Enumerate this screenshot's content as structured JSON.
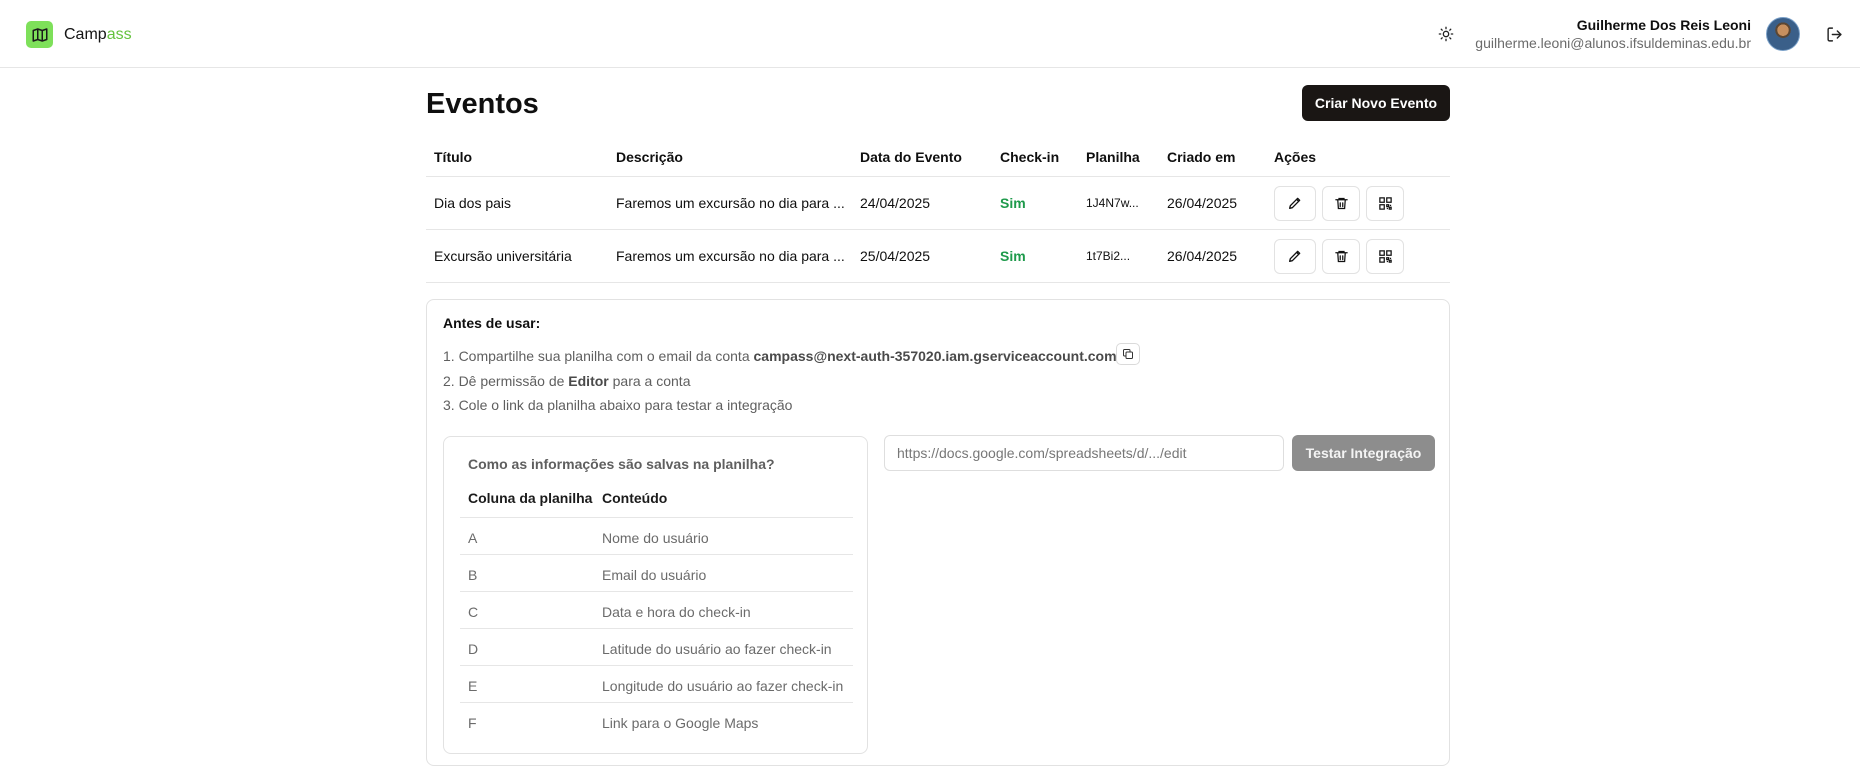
{
  "header": {
    "brand_part1": "Camp",
    "brand_part2": "ass",
    "user_name": "Guilherme Dos Reis Leoni",
    "user_email": "guilherme.leoni@alunos.ifsuldeminas.edu.br",
    "icons": {
      "logo": "map-icon",
      "theme": "sun-icon",
      "logout": "logout-icon"
    }
  },
  "main": {
    "title": "Eventos",
    "create_button": "Criar Novo Evento"
  },
  "events_table": {
    "headers": [
      "Título",
      "Descrição",
      "Data do Evento",
      "Check-in",
      "Planilha",
      "Criado em",
      "Ações"
    ],
    "rows": [
      {
        "titulo": "Dia dos pais",
        "descricao": "Faremos um excursão no dia para ...",
        "data": "24/04/2025",
        "checkin": "Sim",
        "planilha": "1J4N7w...",
        "criado": "26/04/2025"
      },
      {
        "titulo": "Excursão universitária",
        "descricao": "Faremos um excursão no dia para ...",
        "data": "25/04/2025",
        "checkin": "Sim",
        "planilha": "1t7Bi2...",
        "criado": "26/04/2025"
      }
    ],
    "action_icons": [
      "pencil-icon",
      "trash-icon",
      "qr-code-icon"
    ]
  },
  "instructions": {
    "title": "Antes de usar:",
    "step1_prefix": "1. Compartilhe sua planilha com o email da conta ",
    "step1_email": "campass@next-auth-357020.iam.gserviceaccount.com",
    "step2_prefix": "2. Dê permissão de ",
    "step2_bold": "Editor",
    "step2_suffix": " para a conta",
    "step3": "3. Cole o link da planilha abaixo para testar a integração"
  },
  "mapping": {
    "title": "Como as informações são salvas na planilha?",
    "headers": [
      "Coluna da planilha",
      "Conteúdo"
    ],
    "rows": [
      {
        "col": "A",
        "content": "Nome do usuário"
      },
      {
        "col": "B",
        "content": "Email do usuário"
      },
      {
        "col": "C",
        "content": "Data e hora do check-in"
      },
      {
        "col": "D",
        "content": "Latitude do usuário ao fazer check-in"
      },
      {
        "col": "E",
        "content": "Longitude do usuário ao fazer check-in"
      },
      {
        "col": "F",
        "content": "Link para o Google Maps"
      }
    ]
  },
  "integration": {
    "placeholder": "https://docs.google.com/spreadsheets/d/.../edit",
    "button": "Testar Integração"
  },
  "colors": {
    "accent_green": "#7ee05a",
    "brand_green": "#65c23d",
    "success": "#1e9a4b",
    "dark_button": "#1a1614"
  }
}
